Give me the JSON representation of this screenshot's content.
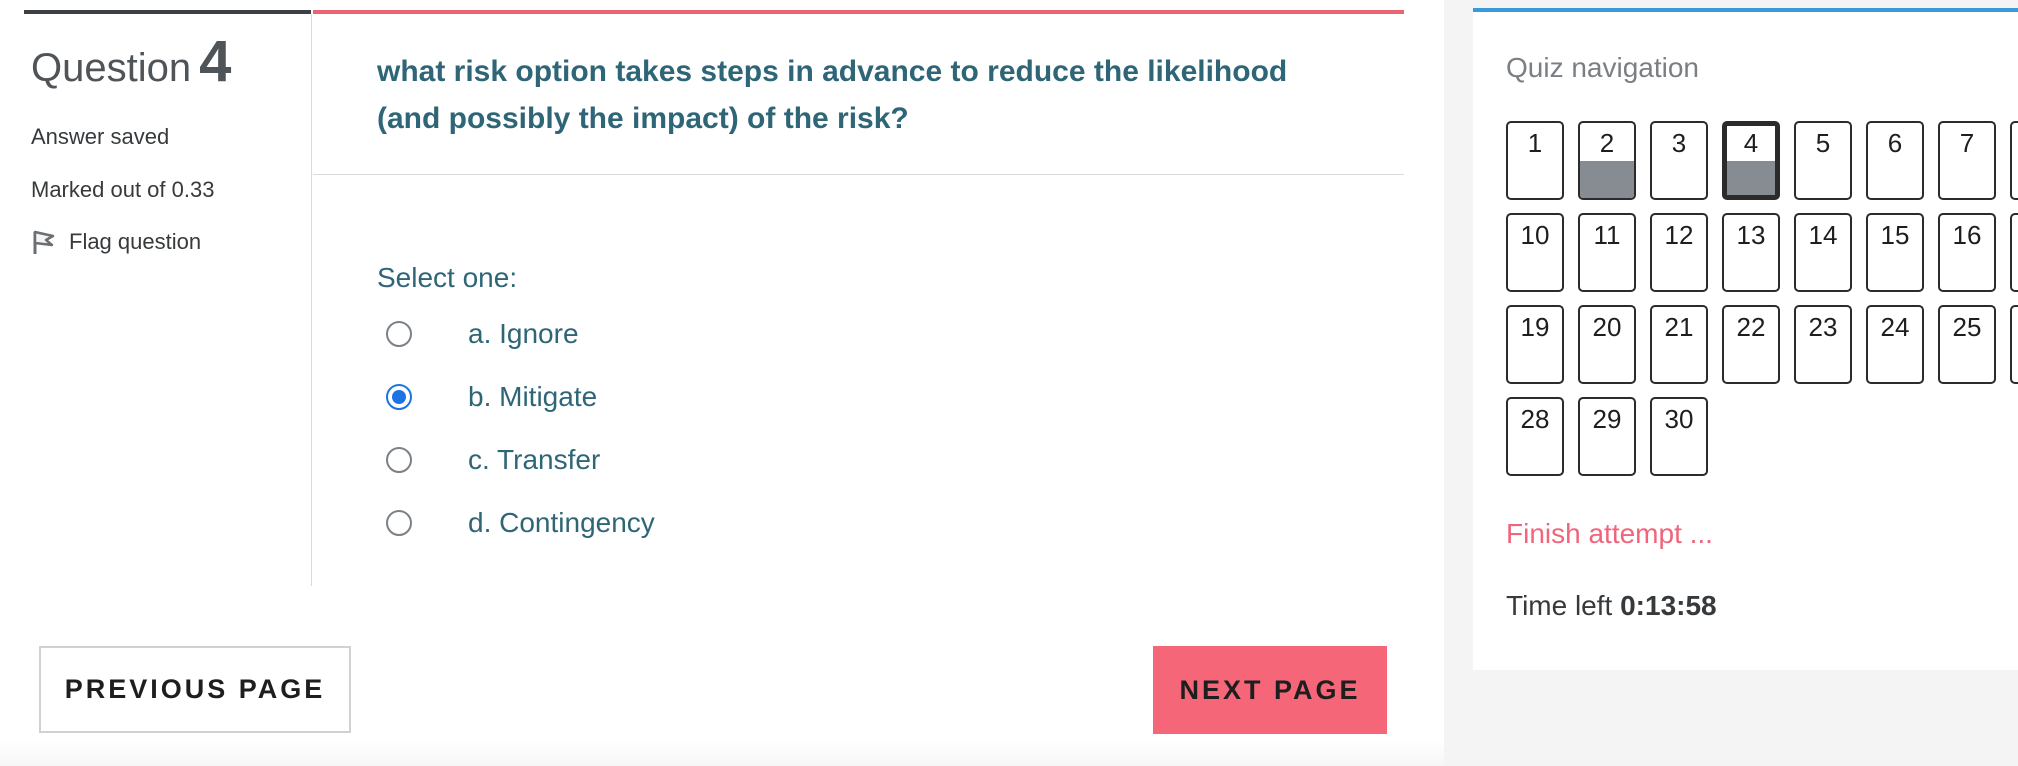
{
  "info": {
    "question_word": "Question",
    "question_number": "4",
    "status": "Answer saved",
    "mark": "Marked out of 0.33",
    "flag_label": "Flag question"
  },
  "question": {
    "text": "what risk option takes steps in advance to reduce the likelihood (and possibly the impact) of the risk?",
    "prompt": "Select one:",
    "options": [
      {
        "label": "a. Ignore",
        "selected": false
      },
      {
        "label": "b. Mitigate",
        "selected": true
      },
      {
        "label": "c. Transfer",
        "selected": false
      },
      {
        "label": "d. Contingency",
        "selected": false
      }
    ]
  },
  "buttons": {
    "previous": "PREVIOUS PAGE",
    "next": "NEXT PAGE"
  },
  "nav": {
    "title": "Quiz navigation",
    "finish": "Finish attempt ...",
    "time_label": "Time left",
    "time_value": "0:13:58",
    "current": 4,
    "answered": [
      2,
      4
    ],
    "total": 30
  },
  "colors": {
    "accent_red": "#f56679",
    "link_red": "#f0657c",
    "question_text": "#2f6677",
    "nav_blue": "#3a9ad9",
    "radio_blue": "#1d73e4"
  }
}
